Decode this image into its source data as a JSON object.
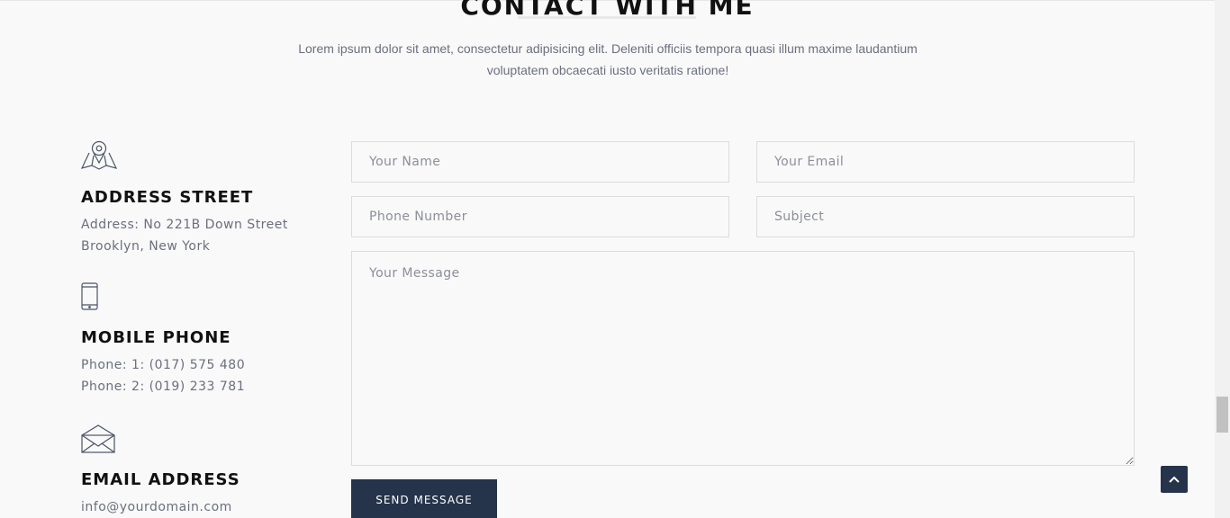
{
  "section": {
    "title": "CONTACT WITH ME",
    "description_line1": "Lorem ipsum dolor sit amet, consectetur adipisicing elit. Deleniti officiis tempora quasi illum maxime laudantium",
    "description_line2": "voluptatem obcaecati iusto veritatis ratione!"
  },
  "contact_info": {
    "address": {
      "icon": "map-pin-icon",
      "heading": "ADDRESS STREET",
      "line1": "Address: No 221B Down Street",
      "line2": "Brooklyn, New York"
    },
    "phone": {
      "icon": "mobile-phone-icon",
      "heading": "MOBILE PHONE",
      "line1": "Phone: 1: (017) 575 480",
      "line2": "Phone: 2: (019) 233 781"
    },
    "email": {
      "icon": "envelope-icon",
      "heading": "EMAIL ADDRESS",
      "line1": "info@yourdomain.com"
    }
  },
  "form": {
    "name_placeholder": "Your Name",
    "email_placeholder": "Your Email",
    "phone_placeholder": "Phone Number",
    "subject_placeholder": "Subject",
    "message_placeholder": "Your Message",
    "submit_label": "SEND MESSAGE"
  },
  "colors": {
    "background": "#f9f9f9",
    "button": "#25344a",
    "text_muted": "#6b6f7e",
    "border": "#dcdcdc"
  },
  "back_to_top_icon": "chevron-up-icon"
}
